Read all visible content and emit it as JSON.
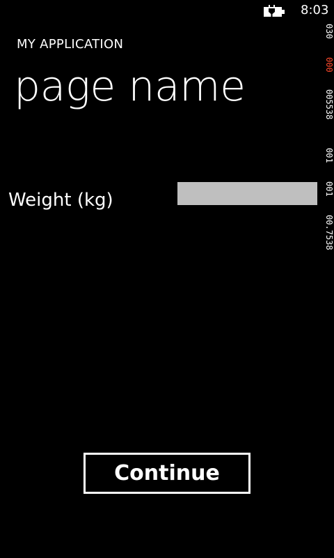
{
  "status_bar": {
    "time": "8:03",
    "battery_icon": "battery-charging-icon"
  },
  "header": {
    "app_title": "MY APPLICATION",
    "page_title": "page name"
  },
  "form": {
    "weight_label": "Weight (kg)",
    "weight_value": ""
  },
  "counters": [
    {
      "text": "030",
      "color": "#ffffff"
    },
    {
      "text": "000",
      "color": "#ff4a2c"
    },
    {
      "text": "005538",
      "color": "#ffffff"
    },
    {
      "text": "001",
      "color": "#ffffff"
    },
    {
      "text": "001",
      "color": "#ffffff"
    },
    {
      "text": "00.7538",
      "color": "#ffffff"
    }
  ],
  "actions": {
    "continue_label": "Continue"
  }
}
